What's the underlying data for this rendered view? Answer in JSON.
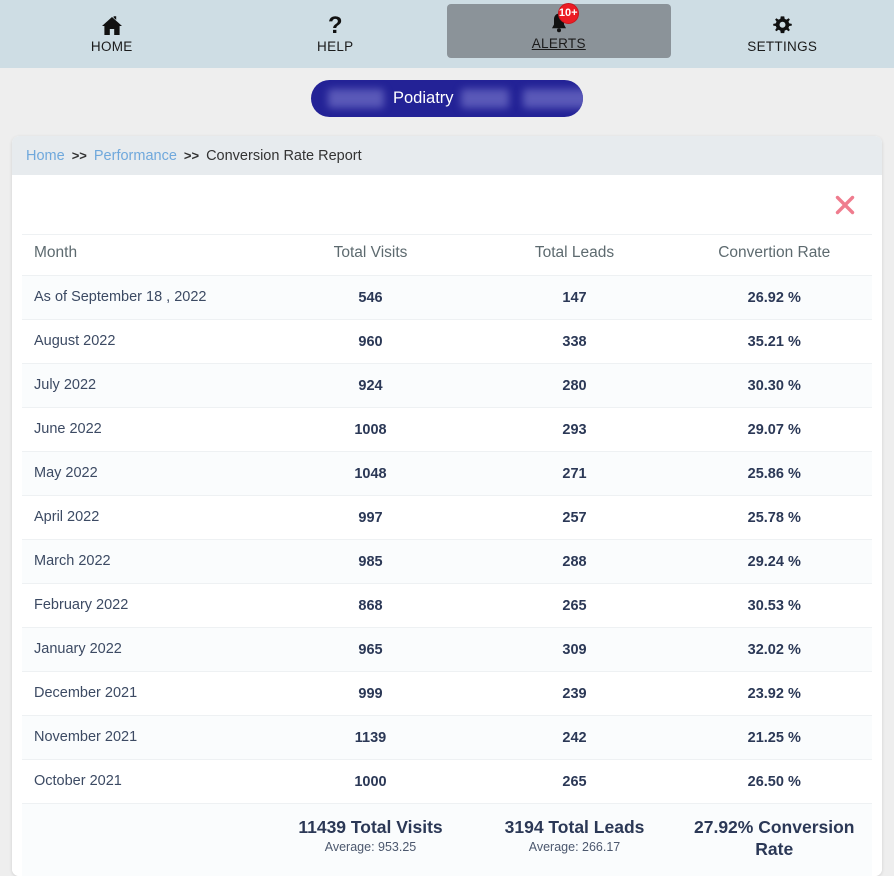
{
  "topnav": {
    "items": [
      {
        "label": "HOME",
        "icon": "home-icon",
        "active": false,
        "badge": null
      },
      {
        "label": "HELP",
        "icon": "question-mark-icon",
        "active": false,
        "badge": null
      },
      {
        "label": "ALERTS",
        "icon": "bell-icon",
        "active": true,
        "badge": "10+"
      },
      {
        "label": "SETTINGS",
        "icon": "gear-icon",
        "active": false,
        "badge": null
      }
    ]
  },
  "title_bar": {
    "text": "Podiatry",
    "background_color": "#232296",
    "redacted": true
  },
  "breadcrumb": {
    "home": "Home",
    "sep1": ">>",
    "performance": "Performance",
    "sep2": ">>",
    "current": "Conversion Rate Report"
  },
  "toolbar": {
    "close_icon": "close-x-icon",
    "close_color": "#ef7c8e"
  },
  "table": {
    "headers": {
      "month": "Month",
      "visits": "Total Visits",
      "leads": "Total Leads",
      "rate": "Convertion Rate"
    },
    "rows": [
      {
        "month": "As of September 18 , 2022",
        "visits": "546",
        "leads": "147",
        "rate": "26.92 %"
      },
      {
        "month": "August 2022",
        "visits": "960",
        "leads": "338",
        "rate": "35.21 %"
      },
      {
        "month": "July 2022",
        "visits": "924",
        "leads": "280",
        "rate": "30.30 %"
      },
      {
        "month": "June 2022",
        "visits": "1008",
        "leads": "293",
        "rate": "29.07 %"
      },
      {
        "month": "May 2022",
        "visits": "1048",
        "leads": "271",
        "rate": "25.86 %"
      },
      {
        "month": "April 2022",
        "visits": "997",
        "leads": "257",
        "rate": "25.78 %"
      },
      {
        "month": "March 2022",
        "visits": "985",
        "leads": "288",
        "rate": "29.24 %"
      },
      {
        "month": "February 2022",
        "visits": "868",
        "leads": "265",
        "rate": "30.53 %"
      },
      {
        "month": "January 2022",
        "visits": "965",
        "leads": "309",
        "rate": "32.02 %"
      },
      {
        "month": "December 2021",
        "visits": "999",
        "leads": "239",
        "rate": "23.92 %"
      },
      {
        "month": "November 2021",
        "visits": "1139",
        "leads": "242",
        "rate": "21.25 %"
      },
      {
        "month": "October 2021",
        "visits": "1000",
        "leads": "265",
        "rate": "26.50 %"
      }
    ],
    "footer": {
      "month": "",
      "visits_total": "11439 Total Visits",
      "visits_average": "Average: 953.25",
      "leads_total": "3194 Total Leads",
      "leads_average": "Average: 266.17",
      "rate_total": "27.92% Conversion Rate",
      "rate_average": ""
    }
  },
  "chart_data": {
    "type": "table",
    "title": "Conversion Rate Report",
    "columns": [
      "Month",
      "Total Visits",
      "Total Leads",
      "Convertion Rate"
    ],
    "categories": [
      "As of September 18 , 2022",
      "August 2022",
      "July 2022",
      "June 2022",
      "May 2022",
      "April 2022",
      "March 2022",
      "February 2022",
      "January 2022",
      "December 2021",
      "November 2021",
      "October 2021"
    ],
    "series": [
      {
        "name": "Total Visits",
        "values": [
          546,
          960,
          924,
          1008,
          1048,
          997,
          985,
          868,
          965,
          999,
          1139,
          1000
        ]
      },
      {
        "name": "Total Leads",
        "values": [
          147,
          338,
          280,
          293,
          271,
          257,
          288,
          265,
          309,
          239,
          242,
          265
        ]
      },
      {
        "name": "Convertion Rate",
        "values": [
          26.92,
          35.21,
          30.3,
          29.07,
          25.86,
          25.78,
          29.24,
          30.53,
          32.02,
          23.92,
          21.25,
          26.5
        ]
      }
    ],
    "totals": {
      "total_visits": 11439,
      "total_leads": 3194,
      "conversion_rate": 27.92,
      "average_visits": 953.25,
      "average_leads": 266.17
    }
  }
}
